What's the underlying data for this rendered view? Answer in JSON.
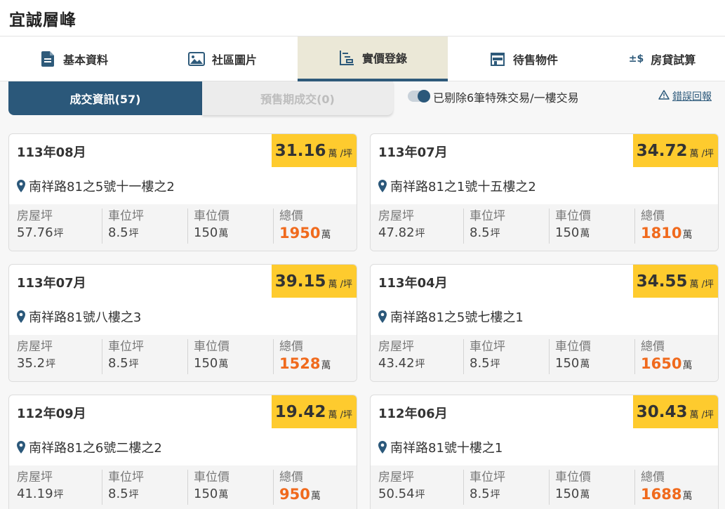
{
  "header": {
    "title": "宜誠層峰"
  },
  "tabs": [
    {
      "label": "基本資料",
      "icon": "document-icon"
    },
    {
      "label": "社區圖片",
      "icon": "image-icon"
    },
    {
      "label": "實價登錄",
      "icon": "price-list-icon"
    },
    {
      "label": "待售物件",
      "icon": "store-icon"
    },
    {
      "label": "房貸試算",
      "icon": "dollar-icon",
      "icon_text": "±$"
    }
  ],
  "active_tab": "實價登錄",
  "segments": {
    "deals": "成交資訊(57)",
    "presale": "預售期成交(0)"
  },
  "filter": {
    "toggle_label": "已剔除6筆特殊交易/一樓交易",
    "enabled": true
  },
  "report_link": "錯誤回報",
  "colors": {
    "primary": "#2b587a",
    "highlight": "#fecb2e",
    "total": "#f06a1d",
    "active_tab_bg": "#ebe8d7"
  },
  "stat_labels": {
    "area": "房屋坪",
    "parking_area": "車位坪",
    "parking_price": "車位價",
    "total": "總價"
  },
  "units": {
    "price_per_ping": "萬 /坪",
    "ping": "坪",
    "wan": "萬"
  },
  "cards": [
    {
      "date": "113年08月",
      "price": "31.16",
      "address": "南祥路81之5號十一樓之2",
      "area": "57.76",
      "parking_area": "8.5",
      "parking_price": "150",
      "total": "1950"
    },
    {
      "date": "113年07月",
      "price": "34.72",
      "address": "南祥路81之1號十五樓之2",
      "area": "47.82",
      "parking_area": "8.5",
      "parking_price": "150",
      "total": "1810"
    },
    {
      "date": "113年07月",
      "price": "39.15",
      "address": "南祥路81號八樓之3",
      "area": "35.2",
      "parking_area": "8.5",
      "parking_price": "150",
      "total": "1528"
    },
    {
      "date": "113年04月",
      "price": "34.55",
      "address": "南祥路81之5號七樓之1",
      "area": "43.42",
      "parking_area": "8.5",
      "parking_price": "150",
      "total": "1650"
    },
    {
      "date": "112年09月",
      "price": "19.42",
      "address": "南祥路81之6號二樓之2",
      "area": "41.19",
      "parking_area": "8.5",
      "parking_price": "150",
      "total": "950"
    },
    {
      "date": "112年06月",
      "price": "30.43",
      "address": "南祥路81號十樓之1",
      "area": "50.54",
      "parking_area": "8.5",
      "parking_price": "150",
      "total": "1688"
    }
  ]
}
